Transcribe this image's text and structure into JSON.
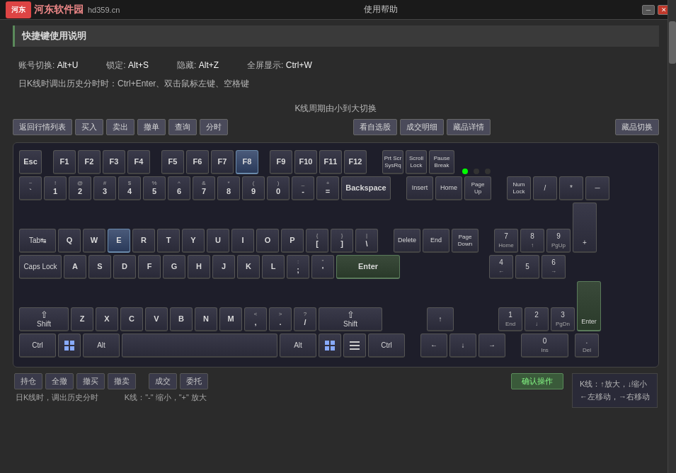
{
  "titlebar": {
    "logo": "河东软件园",
    "subtitle": "hd359.cn",
    "title": "使用帮助",
    "min_btn": "─",
    "close_btn": "✕"
  },
  "page_title": "快捷键使用说明",
  "shortcuts": {
    "row1": [
      {
        "label": "账号切换:",
        "value": "Alt+U"
      },
      {
        "label": "锁定:",
        "value": "Alt+S"
      },
      {
        "label": "隐藏:",
        "value": "Alt+Z"
      },
      {
        "label": "全屏显示:",
        "value": "Ctrl+W"
      }
    ],
    "row2": "日K线时调出历史分时时：Ctrl+Enter、双击鼠标左键、空格键"
  },
  "kline_period": "K线周期由小到大切换",
  "action_buttons": [
    {
      "id": "back",
      "label": "返回行情列表"
    },
    {
      "id": "buy",
      "label": "买入"
    },
    {
      "id": "sell",
      "label": "卖出"
    },
    {
      "id": "cancel",
      "label": "撤单"
    },
    {
      "id": "query",
      "label": "查询"
    },
    {
      "id": "minute",
      "label": "分时"
    },
    {
      "id": "watchlist",
      "label": "看自选股"
    },
    {
      "id": "deal",
      "label": "成交明细"
    },
    {
      "id": "collection",
      "label": "藏品详情"
    },
    {
      "id": "coll_switch",
      "label": "藏品切换"
    }
  ],
  "keyboard": {
    "rows": []
  },
  "bottom_buttons": [
    {
      "id": "hold",
      "label": "持仓"
    },
    {
      "id": "all_撤",
      "label": "全撤"
    },
    {
      "id": "buy_cancel",
      "label": "撤买"
    },
    {
      "id": "sell_cancel",
      "label": "撤卖"
    },
    {
      "id": "deal2",
      "label": "成交"
    },
    {
      "id": "entrust",
      "label": "委托"
    }
  ],
  "confirm_btn": "确认操作",
  "bottom_info_left": "日K线时，调出历史分时",
  "bottom_info_kline": "K线：\"-\" 缩小，\"+\" 放大",
  "kline_info": {
    "line1": "K线：↑放大，↓缩小",
    "line2": "←左移动，→右移动"
  }
}
